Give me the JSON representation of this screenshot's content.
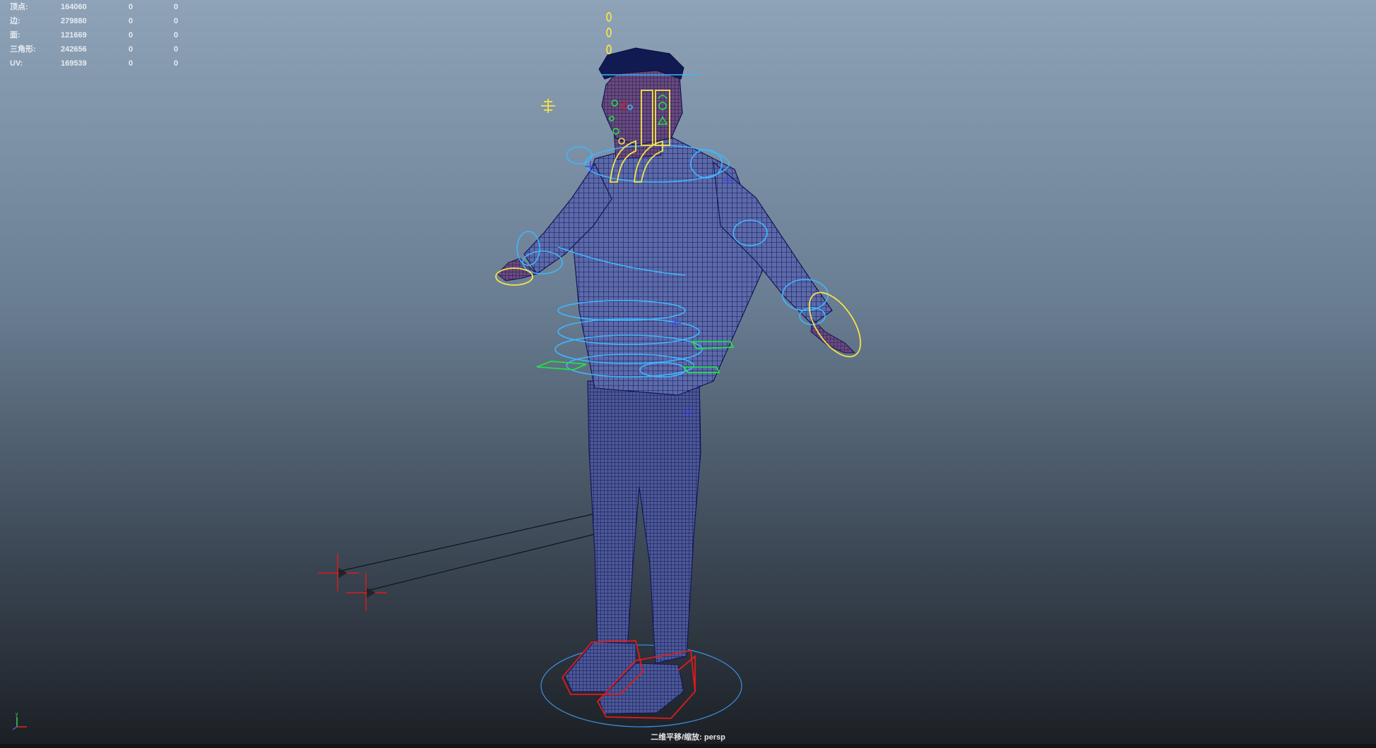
{
  "hud": {
    "rows": [
      {
        "label": "顶点:",
        "count": "164060",
        "sel": "0",
        "tri": "0"
      },
      {
        "label": "边:",
        "count": "279880",
        "sel": "0",
        "tri": "0"
      },
      {
        "label": "面:",
        "count": "121669",
        "sel": "0",
        "tri": "0"
      },
      {
        "label": "三角形:",
        "count": "242656",
        "sel": "0",
        "tri": "0"
      },
      {
        "label": "UV:",
        "count": "169539",
        "sel": "0",
        "tri": "0"
      }
    ]
  },
  "viewport": {
    "camera_label": "二维平移/缩放: persp",
    "background_top": "#8ea2b8",
    "background_bottom": "#1b1f24"
  },
  "axis": {
    "y_label": "y",
    "x_label": "x",
    "z_label": "z"
  },
  "icons": {
    "axis_gizmo": "xyz-axis-icon",
    "pivot_marker": "pivot-cross-icon",
    "ik_pole": "ik-pole-vector-icon"
  },
  "colors": {
    "mesh_wire": "#1a1f6e",
    "control_cyan": "#3fb6ff",
    "control_yellow": "#f5e34a",
    "control_green": "#22e04a",
    "control_red": "#e21a1a"
  }
}
